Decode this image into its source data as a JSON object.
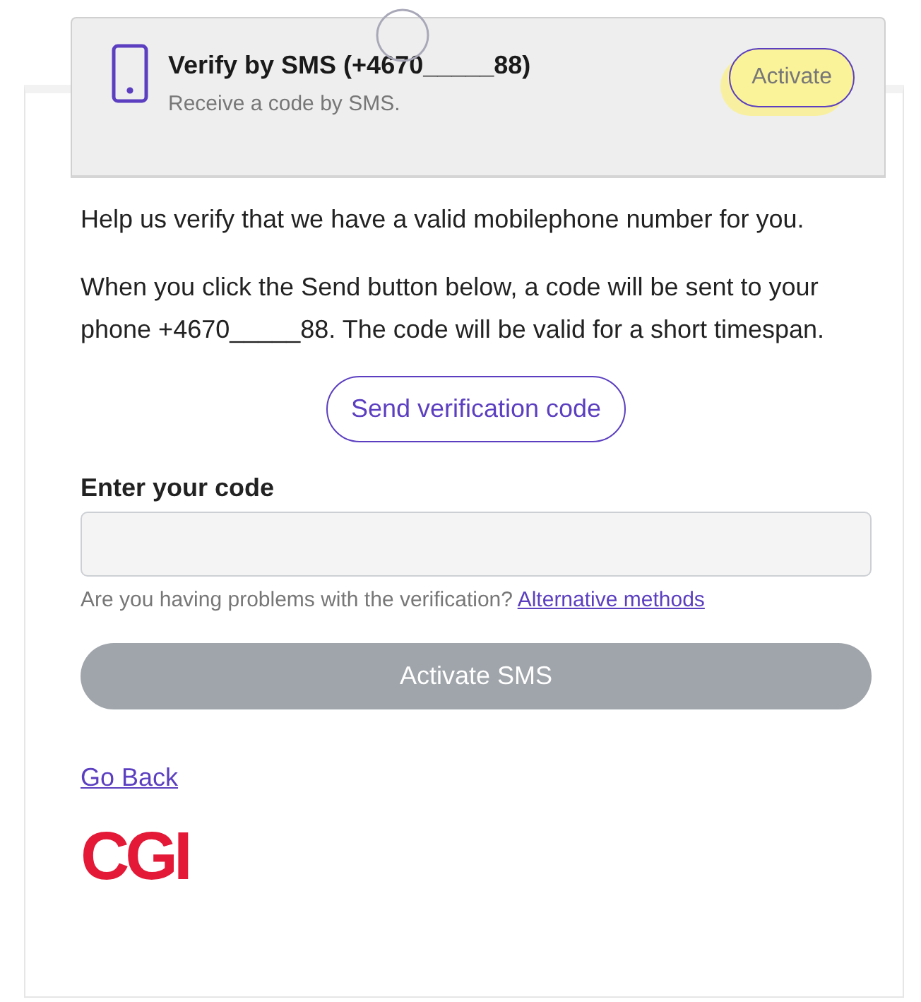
{
  "method_card": {
    "title": "Verify by SMS (+4670_____88)",
    "subtitle": "Receive a code by SMS.",
    "button": "Activate",
    "button_highlighted": true,
    "loading": true
  },
  "intro": "Help us verify that we have a valid mobilephone number for you.",
  "instructions": "When you click the Send button below, a code will be sent to your phone +4670_____88. The code will be valid for a short timespan.",
  "send_button": "Send verification code",
  "code_field": {
    "label": "Enter your code"
  },
  "help": {
    "text": "Are you having problems with the verification?",
    "link": "Alternative methods"
  },
  "submit_button": {
    "label": "Activate SMS",
    "disabled": true
  },
  "back_link": "Go Back",
  "logo": "CGI"
}
